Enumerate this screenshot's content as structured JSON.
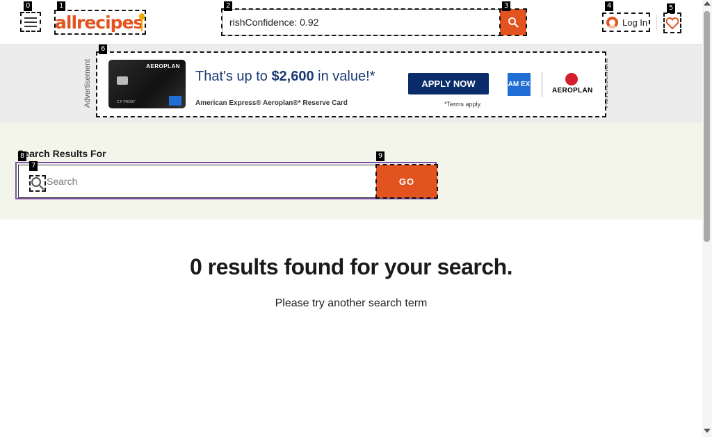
{
  "header": {
    "logo_text": "allrecipes",
    "search_value": "rishConfidence: 0.92",
    "login_label": "Log In"
  },
  "ad": {
    "side_label": "Advertisement",
    "card_brand": "AEROPLAN",
    "card_name": "C F FROST",
    "headline_pre": "That's up to ",
    "headline_bold": "$2,600",
    "headline_post": " in value!*",
    "subline": "American Express® Aeroplan®* Reserve Card",
    "cta": "APPLY NOW",
    "terms": "*Terms apply.",
    "amex_logo": "AM EX",
    "aeroplan_logo": "AEROPLAN"
  },
  "search": {
    "heading": "Search Results For",
    "placeholder": "Search",
    "go_label": "GO"
  },
  "results": {
    "title": "0 results found for your search.",
    "subtitle": "Please try another search term"
  },
  "markers": [
    "0",
    "1",
    "2",
    "3",
    "4",
    "5",
    "6",
    "7",
    "8",
    "9"
  ],
  "colors": {
    "brand": "#e2531f",
    "focus_outline": "#7b4fa1",
    "search_band": "#f3f4ea",
    "ad_band": "#ececec"
  }
}
